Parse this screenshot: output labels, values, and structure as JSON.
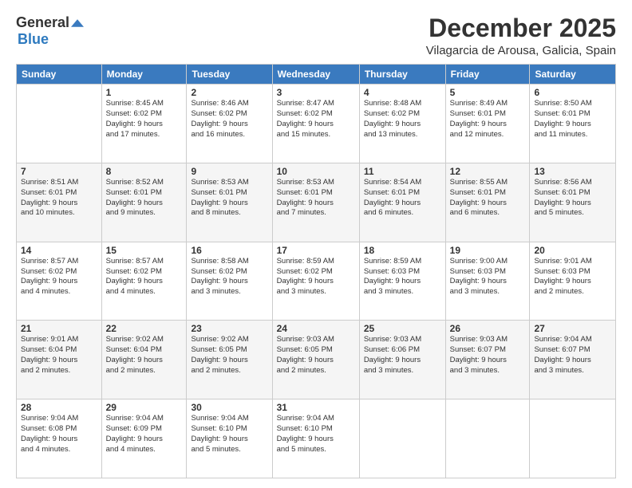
{
  "logo": {
    "general": "General",
    "blue": "Blue"
  },
  "header": {
    "month": "December 2025",
    "location": "Vilagarcia de Arousa, Galicia, Spain"
  },
  "days_of_week": [
    "Sunday",
    "Monday",
    "Tuesday",
    "Wednesday",
    "Thursday",
    "Friday",
    "Saturday"
  ],
  "weeks": [
    [
      {
        "num": "",
        "info": ""
      },
      {
        "num": "1",
        "info": "Sunrise: 8:45 AM\nSunset: 6:02 PM\nDaylight: 9 hours\nand 17 minutes."
      },
      {
        "num": "2",
        "info": "Sunrise: 8:46 AM\nSunset: 6:02 PM\nDaylight: 9 hours\nand 16 minutes."
      },
      {
        "num": "3",
        "info": "Sunrise: 8:47 AM\nSunset: 6:02 PM\nDaylight: 9 hours\nand 15 minutes."
      },
      {
        "num": "4",
        "info": "Sunrise: 8:48 AM\nSunset: 6:02 PM\nDaylight: 9 hours\nand 13 minutes."
      },
      {
        "num": "5",
        "info": "Sunrise: 8:49 AM\nSunset: 6:01 PM\nDaylight: 9 hours\nand 12 minutes."
      },
      {
        "num": "6",
        "info": "Sunrise: 8:50 AM\nSunset: 6:01 PM\nDaylight: 9 hours\nand 11 minutes."
      }
    ],
    [
      {
        "num": "7",
        "info": "Sunrise: 8:51 AM\nSunset: 6:01 PM\nDaylight: 9 hours\nand 10 minutes."
      },
      {
        "num": "8",
        "info": "Sunrise: 8:52 AM\nSunset: 6:01 PM\nDaylight: 9 hours\nand 9 minutes."
      },
      {
        "num": "9",
        "info": "Sunrise: 8:53 AM\nSunset: 6:01 PM\nDaylight: 9 hours\nand 8 minutes."
      },
      {
        "num": "10",
        "info": "Sunrise: 8:53 AM\nSunset: 6:01 PM\nDaylight: 9 hours\nand 7 minutes."
      },
      {
        "num": "11",
        "info": "Sunrise: 8:54 AM\nSunset: 6:01 PM\nDaylight: 9 hours\nand 6 minutes."
      },
      {
        "num": "12",
        "info": "Sunrise: 8:55 AM\nSunset: 6:01 PM\nDaylight: 9 hours\nand 6 minutes."
      },
      {
        "num": "13",
        "info": "Sunrise: 8:56 AM\nSunset: 6:01 PM\nDaylight: 9 hours\nand 5 minutes."
      }
    ],
    [
      {
        "num": "14",
        "info": "Sunrise: 8:57 AM\nSunset: 6:02 PM\nDaylight: 9 hours\nand 4 minutes."
      },
      {
        "num": "15",
        "info": "Sunrise: 8:57 AM\nSunset: 6:02 PM\nDaylight: 9 hours\nand 4 minutes."
      },
      {
        "num": "16",
        "info": "Sunrise: 8:58 AM\nSunset: 6:02 PM\nDaylight: 9 hours\nand 3 minutes."
      },
      {
        "num": "17",
        "info": "Sunrise: 8:59 AM\nSunset: 6:02 PM\nDaylight: 9 hours\nand 3 minutes."
      },
      {
        "num": "18",
        "info": "Sunrise: 8:59 AM\nSunset: 6:03 PM\nDaylight: 9 hours\nand 3 minutes."
      },
      {
        "num": "19",
        "info": "Sunrise: 9:00 AM\nSunset: 6:03 PM\nDaylight: 9 hours\nand 3 minutes."
      },
      {
        "num": "20",
        "info": "Sunrise: 9:01 AM\nSunset: 6:03 PM\nDaylight: 9 hours\nand 2 minutes."
      }
    ],
    [
      {
        "num": "21",
        "info": "Sunrise: 9:01 AM\nSunset: 6:04 PM\nDaylight: 9 hours\nand 2 minutes."
      },
      {
        "num": "22",
        "info": "Sunrise: 9:02 AM\nSunset: 6:04 PM\nDaylight: 9 hours\nand 2 minutes."
      },
      {
        "num": "23",
        "info": "Sunrise: 9:02 AM\nSunset: 6:05 PM\nDaylight: 9 hours\nand 2 minutes."
      },
      {
        "num": "24",
        "info": "Sunrise: 9:03 AM\nSunset: 6:05 PM\nDaylight: 9 hours\nand 2 minutes."
      },
      {
        "num": "25",
        "info": "Sunrise: 9:03 AM\nSunset: 6:06 PM\nDaylight: 9 hours\nand 3 minutes."
      },
      {
        "num": "26",
        "info": "Sunrise: 9:03 AM\nSunset: 6:07 PM\nDaylight: 9 hours\nand 3 minutes."
      },
      {
        "num": "27",
        "info": "Sunrise: 9:04 AM\nSunset: 6:07 PM\nDaylight: 9 hours\nand 3 minutes."
      }
    ],
    [
      {
        "num": "28",
        "info": "Sunrise: 9:04 AM\nSunset: 6:08 PM\nDaylight: 9 hours\nand 4 minutes."
      },
      {
        "num": "29",
        "info": "Sunrise: 9:04 AM\nSunset: 6:09 PM\nDaylight: 9 hours\nand 4 minutes."
      },
      {
        "num": "30",
        "info": "Sunrise: 9:04 AM\nSunset: 6:10 PM\nDaylight: 9 hours\nand 5 minutes."
      },
      {
        "num": "31",
        "info": "Sunrise: 9:04 AM\nSunset: 6:10 PM\nDaylight: 9 hours\nand 5 minutes."
      },
      {
        "num": "",
        "info": ""
      },
      {
        "num": "",
        "info": ""
      },
      {
        "num": "",
        "info": ""
      }
    ]
  ]
}
